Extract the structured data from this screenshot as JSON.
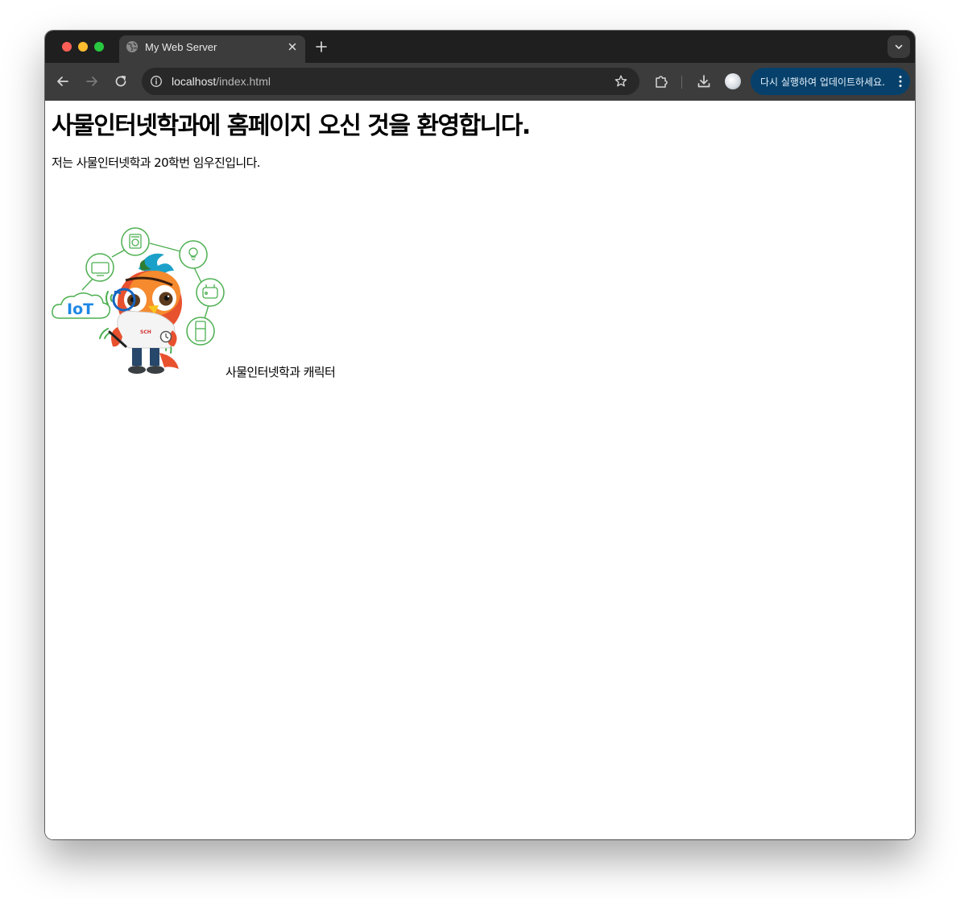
{
  "browser": {
    "tab": {
      "title": "My Web Server"
    },
    "address_bar": {
      "host": "localhost",
      "path": "/index.html"
    },
    "update_button": {
      "label": "다시 실행하여 업데이트하세요."
    },
    "icons": {
      "tab_favicon": "globe-icon",
      "tab_close": "close-icon",
      "new_tab": "plus-icon",
      "tab_search": "chevron-down-icon",
      "back": "arrow-left-icon",
      "forward": "arrow-right-icon",
      "reload": "reload-icon",
      "site_info": "info-icon",
      "bookmark": "star-icon",
      "extensions": "puzzle-icon",
      "downloads": "download-icon",
      "profile": "avatar",
      "menu": "kebab-menu-icon"
    },
    "colors": {
      "tabstrip_bg": "#1f1f1f",
      "toolbar_bg": "#3c3c3c",
      "omnibox_bg": "#282828",
      "update_pill_bg": "#07416b"
    }
  },
  "page": {
    "heading": "사물인터넷학과에 홈페이지 오신 것을 환영합니다.",
    "intro": "저는 사물인터넷학과 20학번 임우진입니다.",
    "image": {
      "cloud_label": "IoT",
      "badge_text": "SCH"
    },
    "caption": "사물인터넷학과 캐릭터"
  }
}
